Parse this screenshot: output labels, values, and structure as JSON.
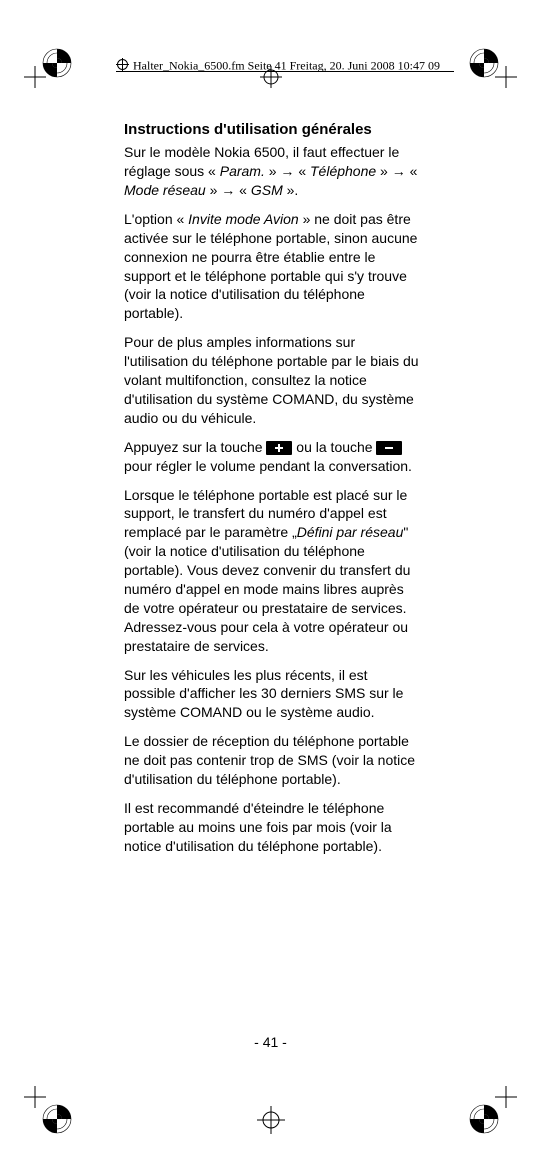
{
  "header": "Halter_Nokia_6500.fm  Seite 41  Freitag, 20. Juni 2008  10:47 09",
  "heading": "Instructions d'utilisation générales",
  "p1a": "Sur le modèle Nokia 6500, il faut effectuer le réglage sous « ",
  "p1_param": "Param.",
  "p1b": " » → « ",
  "p1_tel": "Téléphone",
  "p1c": " » → « ",
  "p1_mode": "Mode réseau",
  "p1d": " » → « ",
  "p1_gsm": "GSM",
  "p1e": " ».",
  "p2a": "L'option « ",
  "p2_invite": "Invite mode Avion",
  "p2b": " » ne doit pas être activée sur le téléphone portable, sinon aucune connexion ne pourra être établie entre le support et le téléphone portable qui s'y trouve (voir la notice d'utilisation du téléphone portable).",
  "p3": "Pour de plus amples informations sur l'utilisation du téléphone portable par le biais du volant multifonction, consultez la notice d'utilisation du système COMAND, du système audio ou du véhicule.",
  "p4a": "Appuyez sur la touche ",
  "p4b": " ou la touche ",
  "p4c": " pour régler le volume pendant la conversation.",
  "p5a": "Lorsque le téléphone portable est placé sur le support, le transfert du numéro d'appel est remplacé par le paramètre „",
  "p5_def": "Défini par réseau",
  "p5b": "\" (voir la notice d'utilisation du téléphone portable). Vous devez convenir du transfert du numéro d'appel en mode mains libres auprès de votre opérateur ou prestataire de services. Adressez-vous pour cela à votre opérateur ou prestataire de services.",
  "p6": "Sur les véhicules les plus récents, il est possible d'afficher les 30 derniers SMS sur le système COMAND ou le système audio.",
  "p7": "Le dossier de réception du téléphone portable ne doit pas contenir trop de SMS (voir la notice d'utilisation du téléphone portable).",
  "p8": "Il est recommandé d'éteindre le téléphone portable au moins une fois par mois (voir la notice d'utilisation du téléphone portable).",
  "page_num": "- 41 -"
}
